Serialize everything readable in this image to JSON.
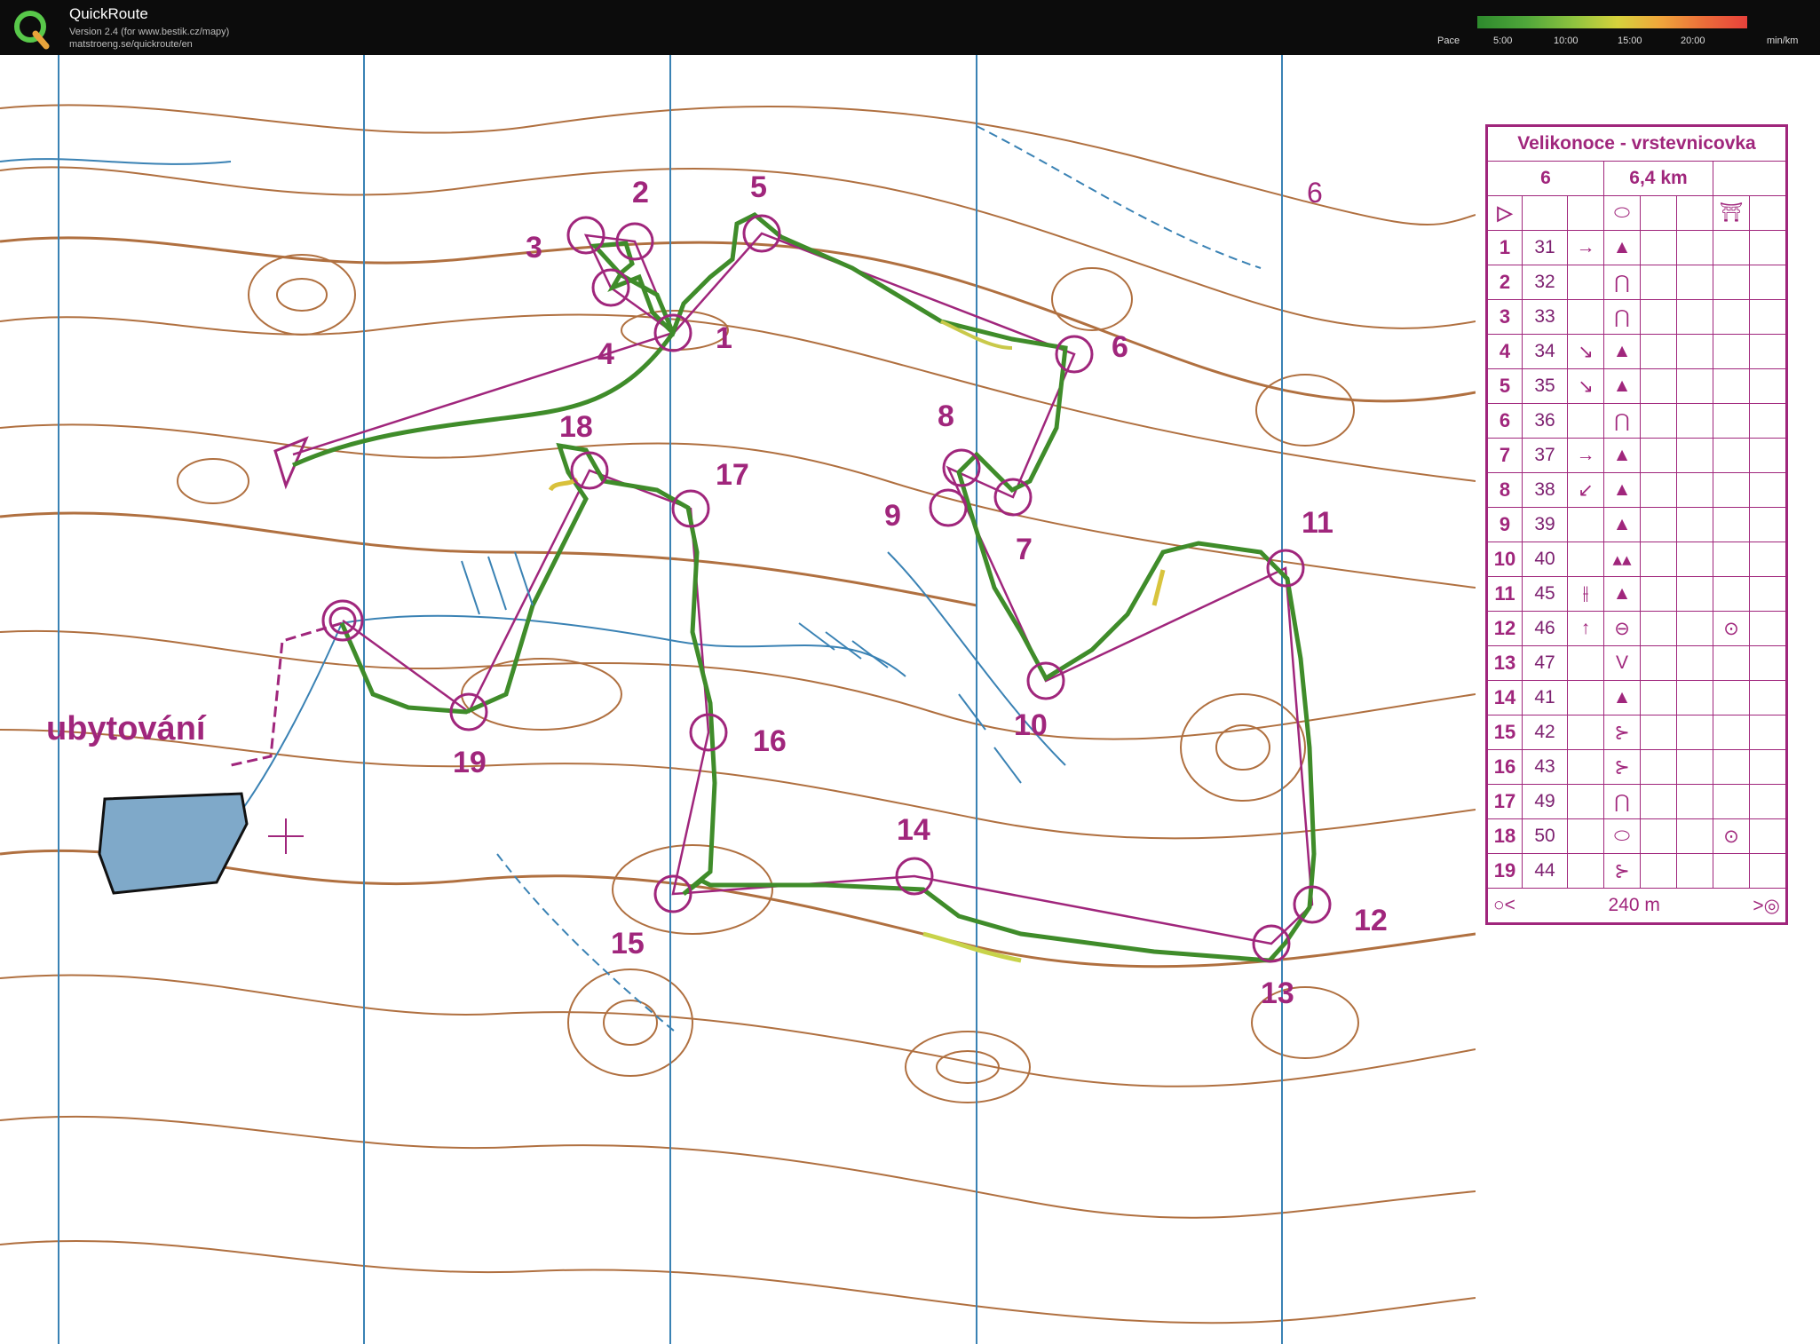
{
  "app": {
    "title": "QuickRoute",
    "version": "Version 2.4  (for www.bestik.cz/mapy)",
    "website": "matstroeng.se/quickroute/en"
  },
  "legend": {
    "label": "Pace",
    "ticks": [
      "5:00",
      "10:00",
      "15:00",
      "20:00"
    ],
    "unit": "min/km"
  },
  "map": {
    "area_label": "ubytování",
    "margin_number": "6",
    "controls": [
      {
        "n": "1"
      },
      {
        "n": "2"
      },
      {
        "n": "3"
      },
      {
        "n": "4"
      },
      {
        "n": "5"
      },
      {
        "n": "6"
      },
      {
        "n": "7"
      },
      {
        "n": "8"
      },
      {
        "n": "9"
      },
      {
        "n": "10"
      },
      {
        "n": "11"
      },
      {
        "n": "12"
      },
      {
        "n": "13"
      },
      {
        "n": "14"
      },
      {
        "n": "15"
      },
      {
        "n": "16"
      },
      {
        "n": "17"
      },
      {
        "n": "18"
      },
      {
        "n": "19"
      }
    ]
  },
  "description": {
    "title": "Velikonoce - vrstevnicovka",
    "category": "6",
    "length": "6,4 km",
    "finish_distance": "240 m",
    "rows": [
      {
        "n": "1",
        "code": "31",
        "c": "→",
        "f": "▲",
        "h": ""
      },
      {
        "n": "2",
        "code": "32",
        "c": "",
        "f": "⋂",
        "h": ""
      },
      {
        "n": "3",
        "code": "33",
        "c": "",
        "f": "⋂",
        "h": ""
      },
      {
        "n": "4",
        "code": "34",
        "c": "↘",
        "f": "▲",
        "h": ""
      },
      {
        "n": "5",
        "code": "35",
        "c": "↘",
        "f": "▲",
        "h": ""
      },
      {
        "n": "6",
        "code": "36",
        "c": "",
        "f": "⋂",
        "h": ""
      },
      {
        "n": "7",
        "code": "37",
        "c": "→",
        "f": "▲",
        "h": ""
      },
      {
        "n": "8",
        "code": "38",
        "c": "↙",
        "f": "▲",
        "h": ""
      },
      {
        "n": "9",
        "code": "39",
        "c": "",
        "f": "▲",
        "h": ""
      },
      {
        "n": "10",
        "code": "40",
        "c": "",
        "f": "▴▴",
        "h": ""
      },
      {
        "n": "11",
        "code": "45",
        "c": "⫲",
        "f": "▲",
        "h": ""
      },
      {
        "n": "12",
        "code": "46",
        "c": "↑",
        "f": "⊖",
        "h": "⊙"
      },
      {
        "n": "13",
        "code": "47",
        "c": "",
        "f": "V",
        "h": ""
      },
      {
        "n": "14",
        "code": "41",
        "c": "",
        "f": "▲",
        "h": ""
      },
      {
        "n": "15",
        "code": "42",
        "c": "",
        "f": "⊱",
        "h": ""
      },
      {
        "n": "16",
        "code": "43",
        "c": "",
        "f": "⊱",
        "h": ""
      },
      {
        "n": "17",
        "code": "49",
        "c": "",
        "f": "⋂",
        "h": ""
      },
      {
        "n": "18",
        "code": "50",
        "c": "",
        "f": "⬭",
        "h": "⊙"
      },
      {
        "n": "19",
        "code": "44",
        "c": "",
        "f": "⊱",
        "h": ""
      }
    ]
  },
  "colors": {
    "course": "#a0267c",
    "route": "#3f8c2a",
    "contour": "#b07040",
    "water": "#3a82b4",
    "lake": "#7fa9c9"
  }
}
